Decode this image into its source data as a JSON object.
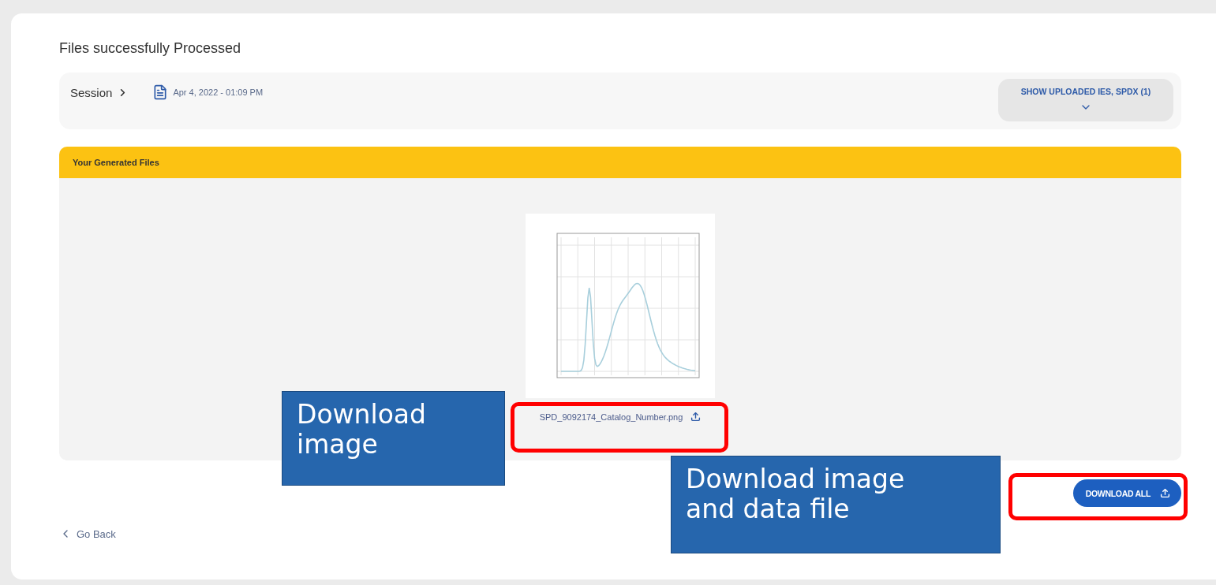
{
  "page_title": "Files successfully Processed",
  "session": {
    "label": "Session",
    "date": "Apr 4, 2022 - 01:09 PM",
    "toggle_label": "SHOW UPLOADED IES, SPDX (1)",
    "expanded": false
  },
  "generated_files": {
    "header": "Your Generated Files",
    "files": [
      {
        "name": "SPD_9092174_Catalog_Number.png"
      }
    ]
  },
  "download_all": "DOWNLOAD ALL",
  "go_back": "Go Back",
  "annotations": [
    {
      "text": "Download image"
    },
    {
      "text": "Download image and data file"
    }
  ]
}
